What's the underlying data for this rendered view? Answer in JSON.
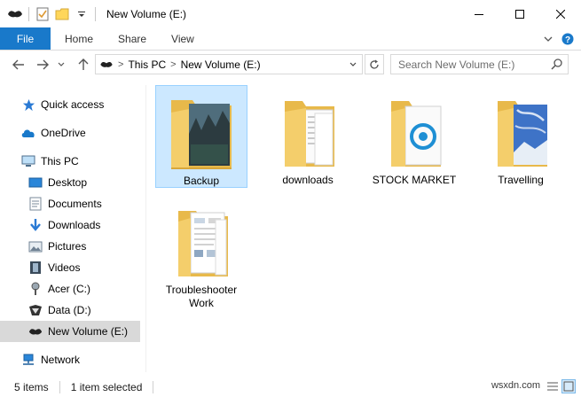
{
  "window": {
    "title": "New Volume (E:)",
    "quick_access_icons": [
      "drive-icon",
      "properties-icon",
      "new-folder-icon",
      "customize-qat-icon"
    ],
    "controls": [
      "minimize",
      "maximize",
      "close"
    ]
  },
  "ribbon": {
    "tabs": [
      "File",
      "Home",
      "Share",
      "View"
    ],
    "active_tab": "File",
    "accent": "#1979ca"
  },
  "address": {
    "breadcrumbs": [
      "This PC",
      "New Volume (E:)"
    ],
    "search_placeholder": "Search New Volume (E:)"
  },
  "nav": {
    "items": [
      {
        "label": "Quick access",
        "icon": "star-icon"
      },
      {
        "label": "OneDrive",
        "icon": "cloud-icon"
      },
      {
        "label": "This PC",
        "icon": "computer-icon"
      },
      {
        "label": "Desktop",
        "icon": "desktop-icon"
      },
      {
        "label": "Documents",
        "icon": "documents-icon"
      },
      {
        "label": "Downloads",
        "icon": "download-arrow-icon"
      },
      {
        "label": "Pictures",
        "icon": "pictures-icon"
      },
      {
        "label": "Videos",
        "icon": "film-icon"
      },
      {
        "label": "Acer (C:)",
        "icon": "drive-icon"
      },
      {
        "label": "Data (D:)",
        "icon": "drive-icon"
      },
      {
        "label": "New Volume (E:)",
        "icon": "drive-icon",
        "selected": true
      },
      {
        "label": "Network",
        "icon": "network-icon"
      }
    ]
  },
  "content": {
    "folders": [
      {
        "label": "Backup",
        "selected": true
      },
      {
        "label": "downloads"
      },
      {
        "label": "STOCK MARKET"
      },
      {
        "label": "Travelling"
      },
      {
        "label": "Troubleshooter Work"
      }
    ]
  },
  "status": {
    "item_count": "5 items",
    "selection": "1 item selected"
  },
  "watermark": "wsxdn.com"
}
